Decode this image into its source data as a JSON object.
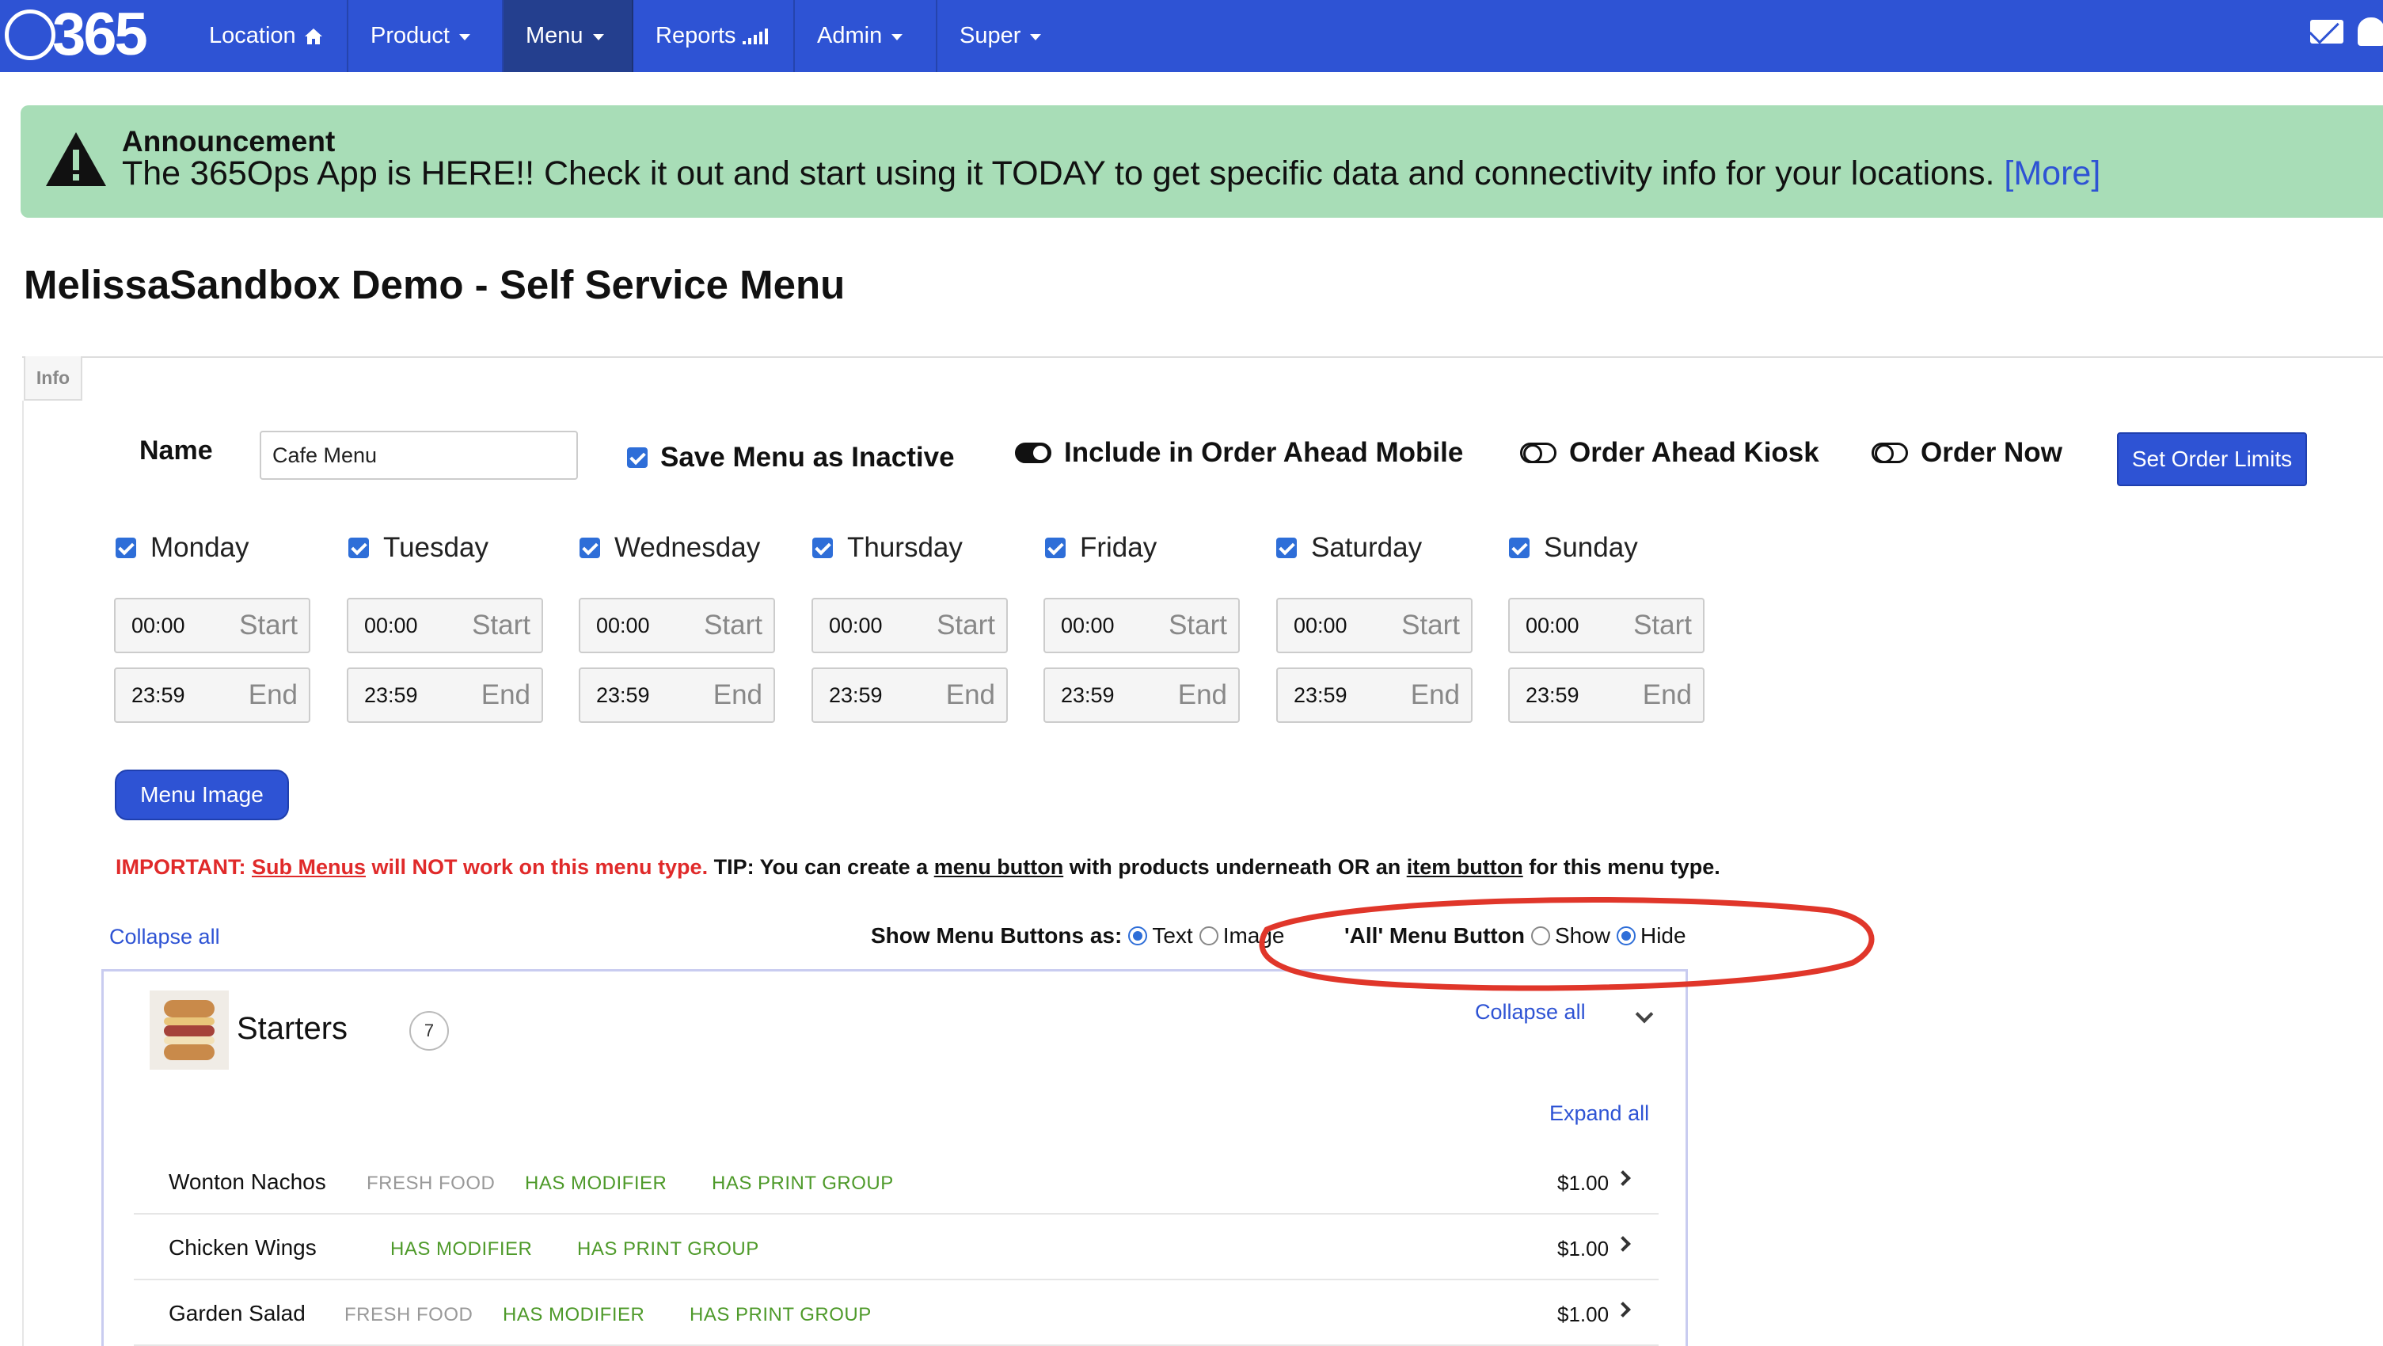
{
  "navbar": {
    "logo_text": "365",
    "items": [
      {
        "label": "Location",
        "icon": "home-icon"
      },
      {
        "label": "Product",
        "icon": "caret-down"
      },
      {
        "label": "Menu",
        "icon": "caret-down",
        "active": true
      },
      {
        "label": "Reports",
        "icon": "signal-bars-icon"
      },
      {
        "label": "Admin",
        "icon": "caret-down"
      },
      {
        "label": "Super",
        "icon": "caret-down"
      }
    ],
    "right_icons": [
      "envelope-icon",
      "bell-icon"
    ],
    "color": "#2e53d4"
  },
  "announcement": {
    "title": "Announcement",
    "text": "The 365Ops App is HERE!! Check it out and start using it TODAY to get specific data and connectivity info for your locations.",
    "link": "[More]",
    "color": "#a8ddb7"
  },
  "page": {
    "title": "MelissaSandbox Demo - Self Service Menu",
    "info_tab": "Info"
  },
  "form": {
    "name_label": "Name",
    "name_value": "Cafe Menu",
    "save_inactive": "Save Menu as Inactive",
    "order_ahead_mobile": "Include in Order Ahead Mobile",
    "order_ahead_kiosk": "Order Ahead Kiosk",
    "order_now": "Order Now",
    "set_order_limits": "Set Order Limits",
    "menu_image": "Menu Image"
  },
  "days": [
    {
      "name": "Monday",
      "start": "00:00",
      "end": "23:59"
    },
    {
      "name": "Tuesday",
      "start": "00:00",
      "end": "23:59"
    },
    {
      "name": "Wednesday",
      "start": "00:00",
      "end": "23:59"
    },
    {
      "name": "Thursday",
      "start": "00:00",
      "end": "23:59"
    },
    {
      "name": "Friday",
      "start": "00:00",
      "end": "23:59"
    },
    {
      "name": "Saturday",
      "start": "00:00",
      "end": "23:59"
    },
    {
      "name": "Sunday",
      "start": "00:00",
      "end": "23:59"
    }
  ],
  "time_labels": {
    "start": "Start",
    "end": "End"
  },
  "notice": {
    "important": "IMPORTANT:",
    "sub_menus": "Sub Menus",
    "will_not": "will NOT work on this menu type.",
    "tip": "TIP: You can create a",
    "menu_button": "menu button",
    "middle": "with products underneath OR an",
    "item_button": "item button",
    "end": "for this menu type."
  },
  "display_options": {
    "collapse_all": "Collapse all",
    "show_as_label": "Show Menu Buttons as:",
    "text_option": "Text",
    "image_option": "Image",
    "all_button_label": "'All' Menu Button",
    "show_option": "Show",
    "hide_option": "Hide",
    "selected_show_as": "Text",
    "selected_all_button": "Hide"
  },
  "starters": {
    "title": "Starters",
    "count": "7",
    "collapse_all": "Collapse all",
    "expand_all": "Expand all",
    "items": [
      {
        "name": "Wonton Nachos",
        "tags": [
          "FRESH FOOD",
          "HAS MODIFIER",
          "HAS PRINT GROUP"
        ],
        "price": "$1.00"
      },
      {
        "name": "Chicken Wings",
        "tags": [
          "HAS MODIFIER",
          "HAS PRINT GROUP"
        ],
        "price": "$1.00"
      },
      {
        "name": "Garden Salad",
        "tags": [
          "FRESH FOOD",
          "HAS MODIFIER",
          "HAS PRINT GROUP"
        ],
        "price": "$1.00"
      }
    ]
  },
  "annotation": {
    "color": "#e0362a",
    "shape": "ellipse"
  }
}
